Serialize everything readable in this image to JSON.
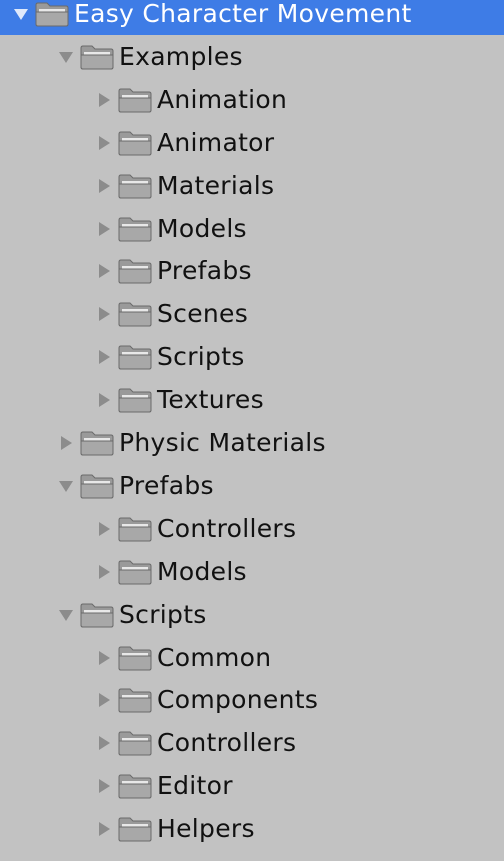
{
  "tree": {
    "items": [
      {
        "label": "Easy Character Movement",
        "depth": 0,
        "expanded": true,
        "selected": true
      },
      {
        "label": "Examples",
        "depth": 1,
        "expanded": true
      },
      {
        "label": "Animation",
        "depth": 2,
        "expanded": false
      },
      {
        "label": "Animator",
        "depth": 2,
        "expanded": false
      },
      {
        "label": "Materials",
        "depth": 2,
        "expanded": false
      },
      {
        "label": "Models",
        "depth": 2,
        "expanded": false
      },
      {
        "label": "Prefabs",
        "depth": 2,
        "expanded": false
      },
      {
        "label": "Scenes",
        "depth": 2,
        "expanded": false
      },
      {
        "label": "Scripts",
        "depth": 2,
        "expanded": false
      },
      {
        "label": "Textures",
        "depth": 2,
        "expanded": false
      },
      {
        "label": "Physic Materials",
        "depth": 1,
        "expanded": false
      },
      {
        "label": "Prefabs",
        "depth": 1,
        "expanded": true
      },
      {
        "label": "Controllers",
        "depth": 2,
        "expanded": false
      },
      {
        "label": "Models",
        "depth": 2,
        "expanded": false
      },
      {
        "label": "Scripts",
        "depth": 1,
        "expanded": true
      },
      {
        "label": "Common",
        "depth": 2,
        "expanded": false
      },
      {
        "label": "Components",
        "depth": 2,
        "expanded": false
      },
      {
        "label": "Controllers",
        "depth": 2,
        "expanded": false
      },
      {
        "label": "Editor",
        "depth": 2,
        "expanded": false
      },
      {
        "label": "Helpers",
        "depth": 2,
        "expanded": false
      }
    ]
  },
  "colors": {
    "background": "#c2c2c2",
    "selection": "#3e7ce6",
    "folder": "#9a9a9a",
    "arrow": "#8c8c8c"
  },
  "icons": {
    "folder": "folder-icon",
    "expanded": "triangle-down-icon",
    "collapsed": "triangle-right-icon"
  }
}
